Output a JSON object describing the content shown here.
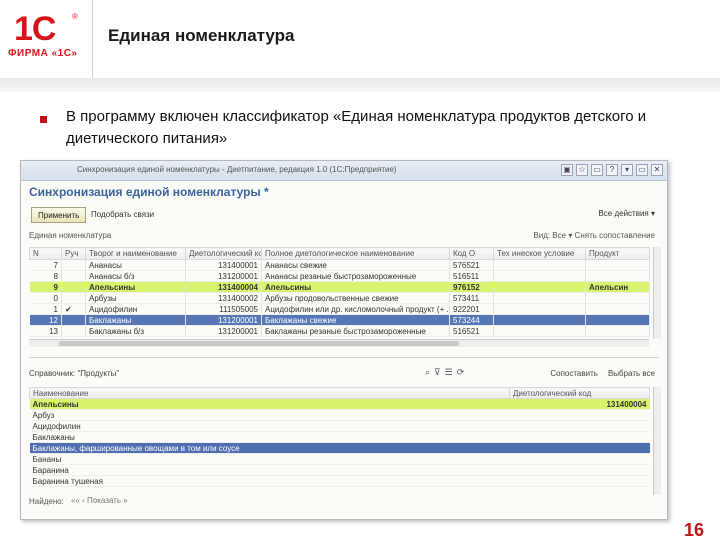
{
  "logo": {
    "main": "1С",
    "reg": "®",
    "sub": "ФИРМА «1С»"
  },
  "slide": {
    "title": "Единая номенклатура",
    "bullet": "В программу включен классификатор «Единая номенклатура продуктов детского и диетического питания»",
    "page_number": "16"
  },
  "window": {
    "title": "Синхронизация единой номенклатуры - Диетпитание, редакция 1.0 (1С:Предприятие)",
    "controls": [
      "▣",
      "☆",
      "▭",
      "?",
      "▾",
      "▭",
      "✕"
    ],
    "form_title": "Синхронизация единой номенклатуры *",
    "toolbar": {
      "primary": "Применить",
      "link": "Подобрать связи",
      "right": "Все действия ▾"
    },
    "filter": {
      "left": "Единая номенклатура",
      "right": "Вид: Все ▾   Снять сопоставление"
    },
    "grid_top": {
      "columns": [
        "N",
        "Руч",
        "Творог и наименование",
        "Диетологический код",
        "Полное диетологическое наименование",
        "Код О",
        "Тех инеское условие",
        "Продукт"
      ],
      "rows": [
        [
          "7",
          "",
          "Ананасы",
          "131400001",
          "Ананасы свежие",
          "576521",
          "",
          ""
        ],
        [
          "8",
          "",
          "Ананасы б/з",
          "131200001",
          "Ананасы резаные быстрозамороженные",
          "516511",
          "",
          ""
        ],
        [
          "9",
          "",
          "Апельсины",
          "131400004",
          "Апельсины",
          "976152",
          "",
          "Апельсин"
        ],
        [
          "0",
          "",
          "Арбузы",
          "131400002",
          "Арбузы продовольственные свежие",
          "573411",
          "",
          ""
        ],
        [
          "1",
          "✔",
          "Ацидофилин",
          "111505005",
          "Ацидофилин или др. кисломолочный продукт (+ ...)",
          "922201",
          "",
          ""
        ],
        [
          "12",
          "",
          "Баклажаны",
          "131200001",
          "Баклажаны свежие",
          "573244",
          "",
          ""
        ],
        [
          "13",
          "",
          "Баклажаны б/з",
          "131200001",
          "Баклажаны резаные быстрозамороженные",
          "516521",
          "",
          ""
        ]
      ]
    },
    "reference": {
      "label": "Справочник: \"Продукты\"",
      "right": [
        "Сопоставить",
        "Выбрать все"
      ]
    },
    "grid_bottom": {
      "columns": [
        "Наименование",
        "Диетологический код"
      ],
      "rows": [
        [
          "Апельсины",
          "131400004"
        ],
        [
          "Арбуз",
          ""
        ],
        [
          "Ацидофилин",
          ""
        ],
        [
          "Баклажаны",
          ""
        ],
        [
          "Баклажаны, фаршированные овощами в том или соусе",
          ""
        ],
        [
          "Бананы",
          ""
        ],
        [
          "Баранина",
          ""
        ],
        [
          "Баранина тушеная",
          ""
        ]
      ]
    },
    "found_label": "Найдено:",
    "found_controls": "«« ‹ Показать »"
  }
}
